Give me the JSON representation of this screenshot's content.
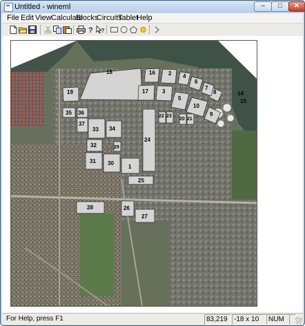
{
  "window": {
    "title": "Untitled - wineml",
    "min_label": "–",
    "max_label": "□",
    "close_label": "✕"
  },
  "menu": [
    "File",
    "Edit",
    "View",
    "Calculate",
    "Blocks",
    "Circuits",
    "Tablet",
    "Help"
  ],
  "toolbar": {
    "left_group": [
      "new-file-icon",
      "open-folder-icon",
      "save-icon"
    ],
    "edit_group": [
      "cut-icon",
      "copy-icon",
      "paste-icon"
    ],
    "tool_group": [
      "print-icon",
      "about-icon",
      "context-help-icon"
    ],
    "shape_group": [
      "rectangle-icon",
      "circle-icon",
      "polygon-icon",
      "sun-icon",
      "play-icon"
    ]
  },
  "blocks": [
    {
      "label": "18"
    },
    {
      "label": "16"
    },
    {
      "label": "2"
    },
    {
      "label": "4"
    },
    {
      "label": "6"
    },
    {
      "label": "8"
    },
    {
      "label": "14"
    },
    {
      "label": "15"
    },
    {
      "label": "19"
    },
    {
      "label": "17"
    },
    {
      "label": "3"
    },
    {
      "label": "5"
    },
    {
      "label": "10"
    },
    {
      "label": "9"
    },
    {
      "label": "7"
    },
    {
      "label": "35"
    },
    {
      "label": "36"
    },
    {
      "label": "37"
    },
    {
      "label": "33"
    },
    {
      "label": "34"
    },
    {
      "label": "22"
    },
    {
      "label": "23"
    },
    {
      "label": "20"
    },
    {
      "label": "21"
    },
    {
      "label": "24"
    },
    {
      "label": "32"
    },
    {
      "label": "29"
    },
    {
      "label": "31"
    },
    {
      "label": "30"
    },
    {
      "label": "1"
    },
    {
      "label": "25"
    },
    {
      "label": "28"
    },
    {
      "label": "26"
    },
    {
      "label": "27"
    }
  ],
  "status": {
    "help_text": "For Help, press F1",
    "coords": "83,219",
    "scale": "-18 x 10",
    "num": "NUM"
  }
}
